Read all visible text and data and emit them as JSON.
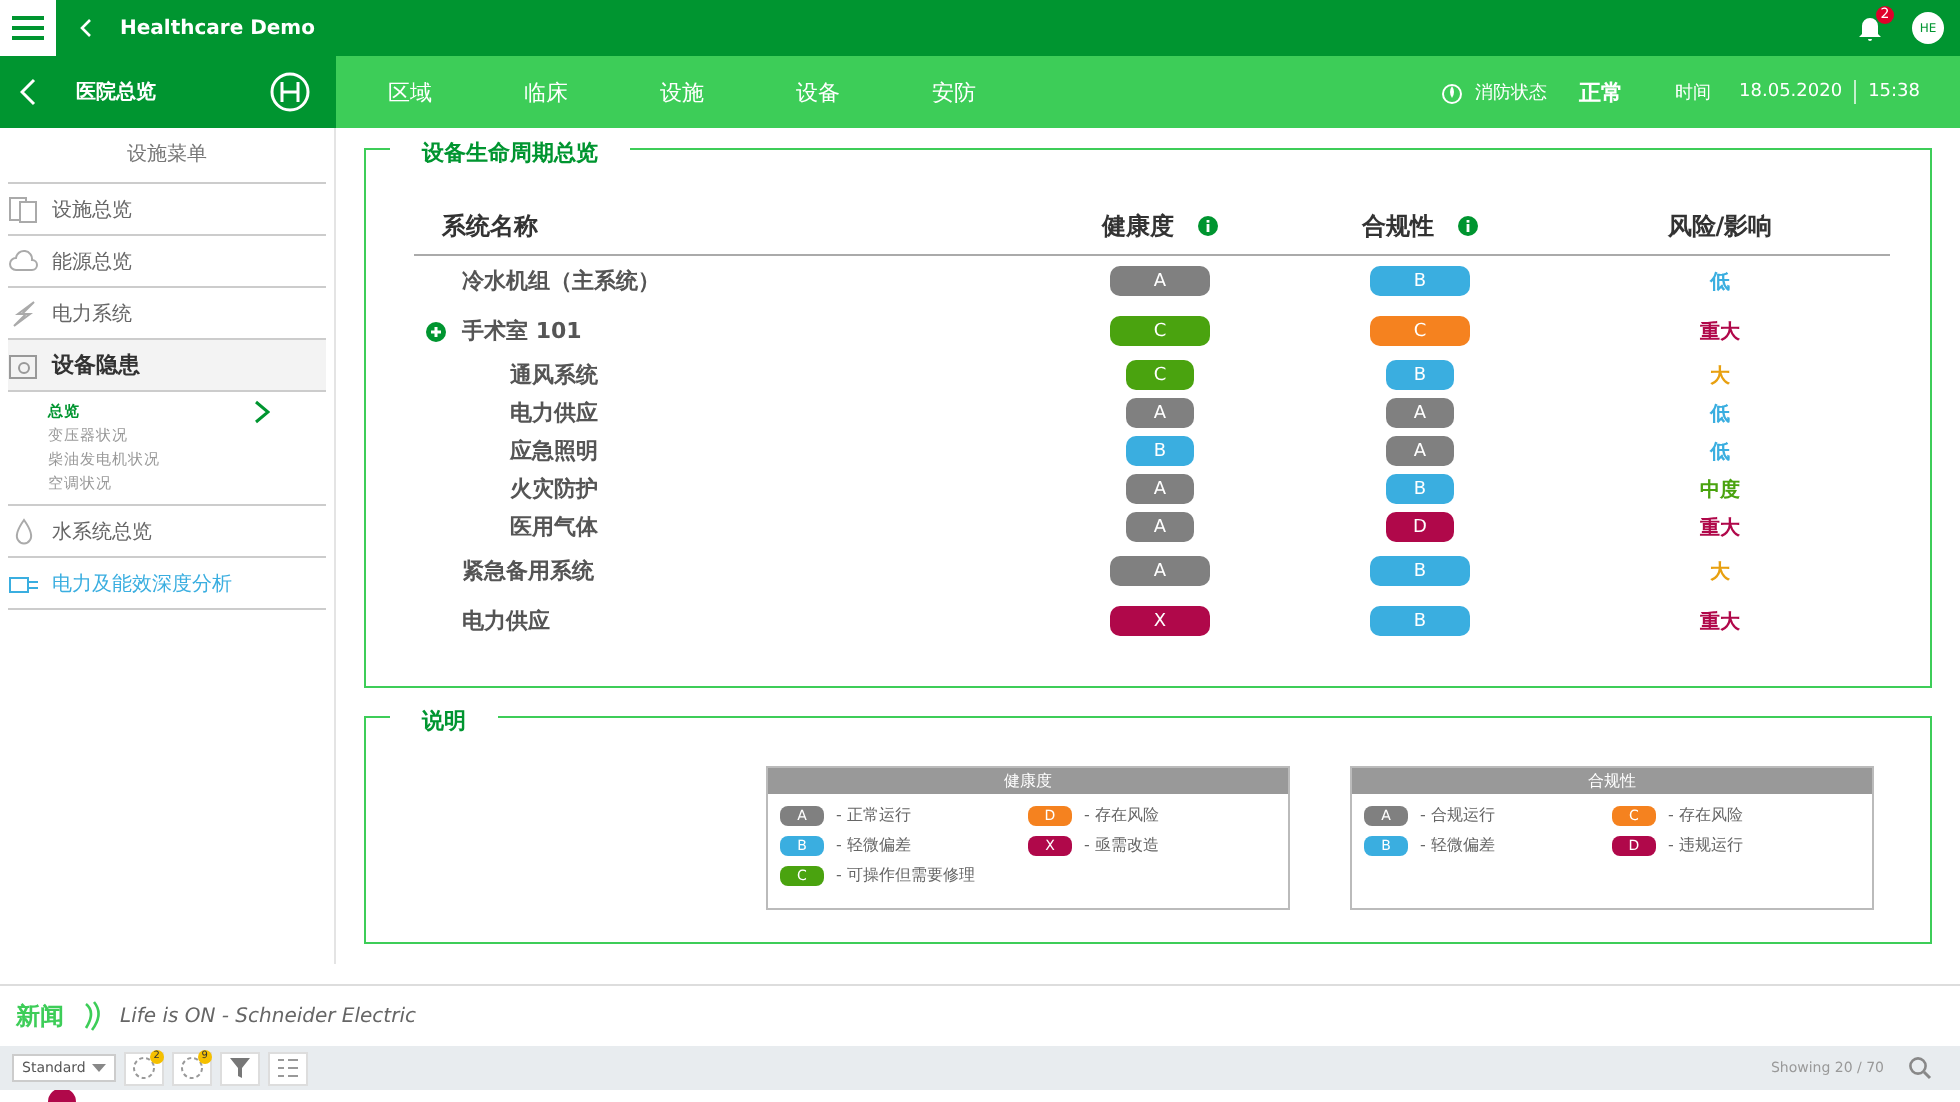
{
  "top_bar": {
    "app_title": "Healthcare Demo",
    "notification_count": "2",
    "avatar": "HE"
  },
  "sub_bar": {
    "title": "医院总览",
    "tabs": [
      {
        "label": "区域",
        "selected": false
      },
      {
        "label": "临床",
        "selected": false
      },
      {
        "label": "设施",
        "selected": false
      },
      {
        "label": "设备",
        "selected": false
      },
      {
        "label": "安防",
        "selected": false
      }
    ],
    "fire_status_label": "消防状态",
    "fire_status": "正常",
    "time_label": "时间",
    "date": "18.05.2020",
    "time": "15:38"
  },
  "sidebar": {
    "header": "设施菜单",
    "items": [
      {
        "label": "设施总览",
        "kind": "normal",
        "expanded": false
      },
      {
        "label": "能源总览",
        "kind": "normal",
        "expanded": false
      },
      {
        "label": "电力系统",
        "kind": "normal",
        "expanded": false
      },
      {
        "label": "设备隐患",
        "kind": "normal",
        "expanded": true,
        "children": [
          {
            "label": "总览",
            "selected": true
          },
          {
            "label": "变压器状况",
            "selected": false
          },
          {
            "label": "柴油发电机状况",
            "selected": false
          },
          {
            "label": "空调状况",
            "selected": false
          }
        ]
      },
      {
        "label": "水系统总览",
        "kind": "normal",
        "expanded": false
      },
      {
        "label": "电力及能效深度分析",
        "kind": "link",
        "expanded": false
      }
    ]
  },
  "overview": {
    "title": "设备生命周期总览",
    "columns": [
      "系统名称",
      "健康度",
      "合规性",
      "风险/影响"
    ],
    "rows": [
      {
        "name": "冷水机组（主系统）",
        "health": {
          "grade": "A",
          "color": "#808080"
        },
        "compliance": {
          "grade": "B",
          "color": "#3aaee0"
        },
        "risk": {
          "text": "低",
          "color": "#3aaee0"
        }
      },
      {
        "name": "手术室 101",
        "health": {
          "grade": "C",
          "color": "#4aa30f"
        },
        "compliance": {
          "grade": "C",
          "color": "#f5821f"
        },
        "risk": {
          "text": "重大",
          "color": "#b0084a"
        },
        "children": [
          {
            "name": "通风系统",
            "health": {
              "grade": "C",
              "color": "#4aa30f"
            },
            "compliance": {
              "grade": "B",
              "color": "#3aaee0"
            },
            "risk": {
              "text": "大",
              "color": "#e8a010"
            }
          },
          {
            "name": "电力供应",
            "health": {
              "grade": "A",
              "color": "#808080"
            },
            "compliance": {
              "grade": "A",
              "color": "#808080"
            },
            "risk": {
              "text": "低",
              "color": "#3aaee0"
            }
          },
          {
            "name": "应急照明",
            "health": {
              "grade": "B",
              "color": "#3aaee0"
            },
            "compliance": {
              "grade": "A",
              "color": "#808080"
            },
            "risk": {
              "text": "低",
              "color": "#3aaee0"
            }
          },
          {
            "name": "火灾防护",
            "health": {
              "grade": "A",
              "color": "#808080"
            },
            "compliance": {
              "grade": "B",
              "color": "#3aaee0"
            },
            "risk": {
              "text": "中度",
              "color": "#4aa30f"
            }
          },
          {
            "name": "医用气体",
            "health": {
              "grade": "A",
              "color": "#808080"
            },
            "compliance": {
              "grade": "D",
              "color": "#b0084a"
            },
            "risk": {
              "text": "重大",
              "color": "#b0084a"
            }
          }
        ]
      },
      {
        "name": "紧急备用系统",
        "health": {
          "grade": "A",
          "color": "#808080"
        },
        "compliance": {
          "grade": "B",
          "color": "#3aaee0"
        },
        "risk": {
          "text": "大",
          "color": "#e8a010"
        }
      },
      {
        "name": "电力供应",
        "health": {
          "grade": "X",
          "color": "#b0084a"
        },
        "compliance": {
          "grade": "B",
          "color": "#3aaee0"
        },
        "risk": {
          "text": "重大",
          "color": "#b0084a"
        }
      }
    ]
  },
  "legend": {
    "title": "说明",
    "groups": [
      {
        "title": "健康度",
        "items": [
          {
            "grade": "A",
            "color": "#808080",
            "text": "- 正常运行"
          },
          {
            "grade": "D",
            "color": "#f5821f",
            "text": "- 存在风险"
          },
          {
            "grade": "B",
            "color": "#3aaee0",
            "text": "- 轻微偏差"
          },
          {
            "grade": "X",
            "color": "#b0084a",
            "text": "- 亟需改造"
          },
          {
            "grade": "C",
            "color": "#4aa30f",
            "text": "- 可操作但需要修理"
          }
        ]
      },
      {
        "title": "合规性",
        "items": [
          {
            "grade": "A",
            "color": "#808080",
            "text": "- 合规运行"
          },
          {
            "grade": "C",
            "color": "#f5821f",
            "text": "- 存在风险"
          },
          {
            "grade": "B",
            "color": "#3aaee0",
            "text": "- 轻微偏差"
          },
          {
            "grade": "D",
            "color": "#b0084a",
            "text": "- 违规运行"
          }
        ]
      }
    ]
  },
  "news": {
    "label": "新闻",
    "text": "Life is ON - Schneider Electric"
  },
  "toolbar": {
    "view": "Standard",
    "badges": [
      "2",
      "9"
    ],
    "showing": "Showing 20 / 70"
  }
}
